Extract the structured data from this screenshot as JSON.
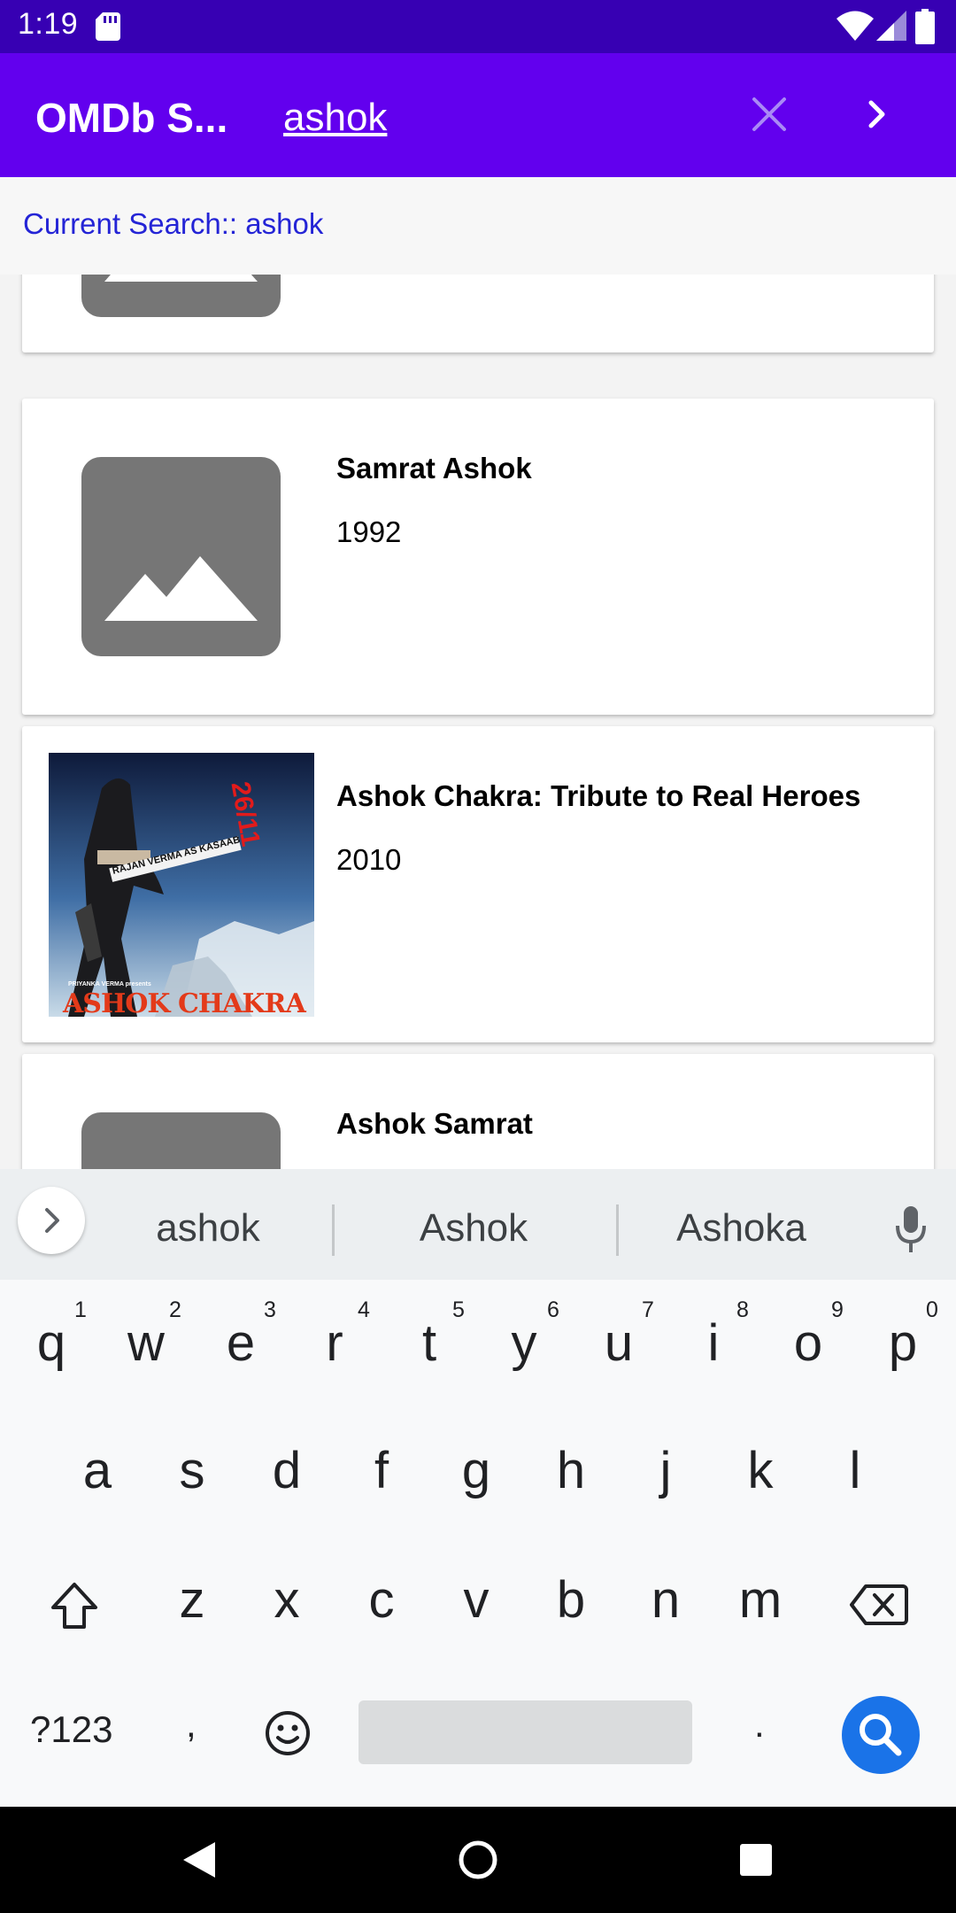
{
  "status_bar": {
    "time": "1:19",
    "icons": [
      "sd-card-icon",
      "wifi-icon",
      "signal-icon",
      "battery-icon"
    ]
  },
  "app_bar": {
    "title": "OMDb S...",
    "search_value": "ashok",
    "clear_icon": "close-icon",
    "submit_icon": "chevron-right-icon"
  },
  "current_search": {
    "label": "Current Search:: ashok"
  },
  "results": [
    {
      "title": "",
      "year": "",
      "poster": "placeholder-image-icon"
    },
    {
      "title": "Samrat Ashok",
      "year": "1992",
      "poster": "placeholder-image-icon"
    },
    {
      "title": "Ashok Chakra: Tribute to Real Heroes",
      "year": "2010",
      "poster": "movie-poster",
      "poster_text": {
        "headline": "ASHOK CHAKRA",
        "credit": "RAJAN VERMA AS KASAAB",
        "presenter": "PRIYANKA VERMA presents",
        "side": "26/11"
      }
    },
    {
      "title": "Ashok Samrat",
      "year": "",
      "poster": "placeholder-image-icon"
    }
  ],
  "keyboard": {
    "suggestions": [
      "ashok",
      "Ashok",
      "Ashoka"
    ],
    "row1": [
      "q",
      "w",
      "e",
      "r",
      "t",
      "y",
      "u",
      "i",
      "o",
      "p"
    ],
    "row1_hints": [
      "1",
      "2",
      "3",
      "4",
      "5",
      "6",
      "7",
      "8",
      "9",
      "0"
    ],
    "row2": [
      "a",
      "s",
      "d",
      "f",
      "g",
      "h",
      "j",
      "k",
      "l"
    ],
    "row3": [
      "z",
      "x",
      "c",
      "v",
      "b",
      "n",
      "m"
    ],
    "symbols_key": "?123",
    "comma_key": ",",
    "period_key": "."
  },
  "colors": {
    "status_bar": "#3700b3",
    "app_bar": "#6200ee",
    "current_search_text": "#2424d6",
    "placeholder": "#767676",
    "search_key": "#1a73e8"
  }
}
